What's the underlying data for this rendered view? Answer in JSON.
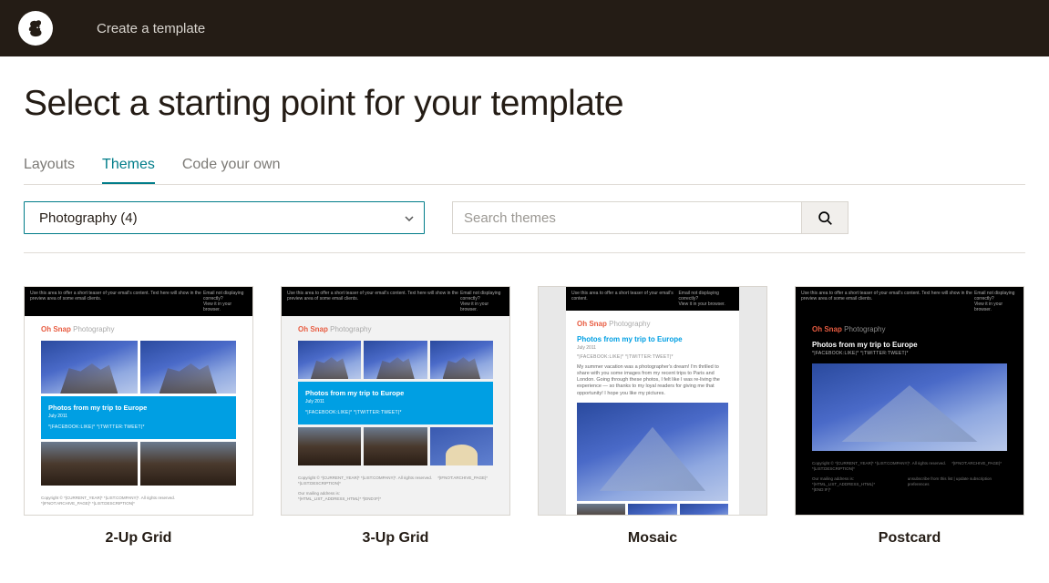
{
  "header": {
    "title": "Create a template"
  },
  "page": {
    "title": "Select a starting point for your template"
  },
  "tabs": [
    {
      "label": "Layouts",
      "active": false
    },
    {
      "label": "Themes",
      "active": true
    },
    {
      "label": "Code your own",
      "active": false
    }
  ],
  "filter": {
    "selected": "Photography (4)"
  },
  "search": {
    "placeholder": "Search themes"
  },
  "preview": {
    "brand1": "Oh Snap",
    "brand2": " Photography",
    "headline": "Photos from my trip to Europe",
    "date": "July 2011",
    "social": "*|FACEBOOK:LIKE|* *|TWITTER:TWEET|*",
    "mosaic_body": "My summer vacation was a photographer's dream! I'm thrilled to share with you some images from my recent trips to Paris and London. Going through these photos, I felt like I was re-living the experience — so thanks to my loyal readers for giving me that opportunity! I hope you like my pictures."
  },
  "themes": [
    {
      "label": "2-Up Grid"
    },
    {
      "label": "3-Up Grid"
    },
    {
      "label": "Mosaic"
    },
    {
      "label": "Postcard"
    }
  ]
}
